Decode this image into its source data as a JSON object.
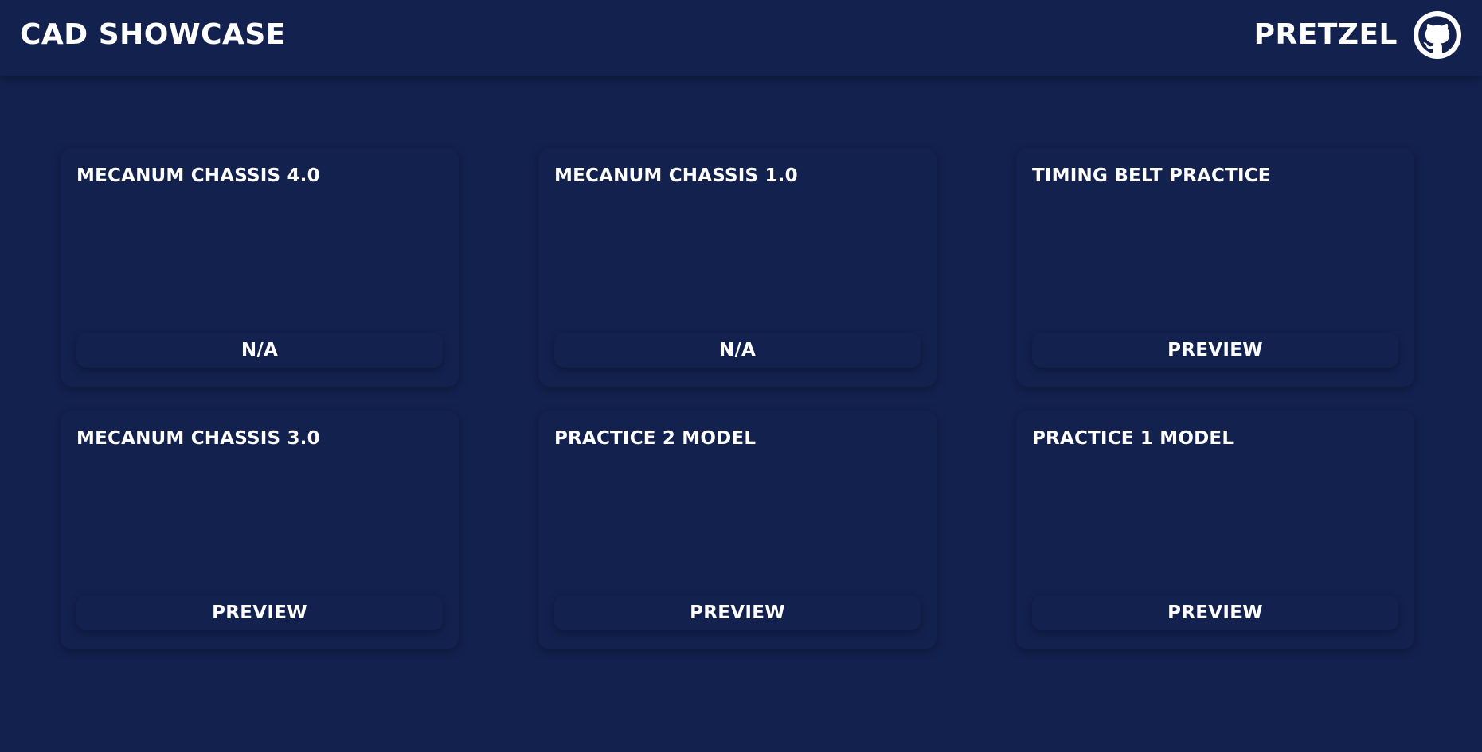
{
  "header": {
    "title": "CAD SHOWCASE",
    "username": "PRETZEL",
    "github_icon": "github-icon"
  },
  "colors": {
    "background": "#13214f",
    "text": "#ffffff"
  },
  "cards": [
    {
      "title": "MECANUM CHASSIS 4.0",
      "button_label": "N/A"
    },
    {
      "title": "MECANUM CHASSIS 1.0",
      "button_label": "N/A"
    },
    {
      "title": "TIMING BELT PRACTICE",
      "button_label": "PREVIEW"
    },
    {
      "title": "MECANUM CHASSIS 3.0",
      "button_label": "PREVIEW"
    },
    {
      "title": "PRACTICE 2 MODEL",
      "button_label": "PREVIEW"
    },
    {
      "title": "PRACTICE 1 MODEL",
      "button_label": "PREVIEW"
    }
  ]
}
